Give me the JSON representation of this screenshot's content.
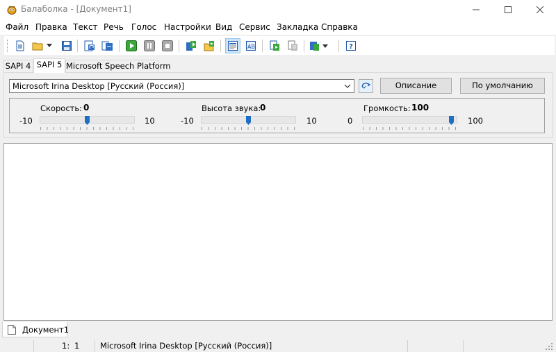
{
  "window": {
    "title": "Балаболка - [Документ1]",
    "icon": "bee-app-icon"
  },
  "menu": [
    "Файл",
    "Правка",
    "Текст",
    "Речь",
    "Голос",
    "Настройки",
    "Вид",
    "Сервис",
    "Закладка",
    "Справка"
  ],
  "toolbar": {
    "icons": [
      "new-document-icon",
      "open-folder-icon",
      "save-icon",
      "export-audio-icon",
      "batch-convert-icon",
      "play-icon",
      "pause-icon",
      "stop-icon",
      "read-clipboard-icon",
      "read-file-icon",
      "toggle-panel-icon",
      "text-format-icon",
      "audio-clip-icon",
      "clip-list-icon",
      "voice-settings-icon",
      "help-icon"
    ]
  },
  "tabs": {
    "items": [
      "SAPI 4",
      "SAPI 5",
      "Microsoft Speech Platform"
    ],
    "active": "SAPI 5"
  },
  "voice": {
    "selected": "Microsoft Irina Desktop [Русский (Россия)]",
    "describe_button": "Описание",
    "default_button": "По умолчанию"
  },
  "sliders": {
    "rate": {
      "label": "Скорость:",
      "value": "0",
      "min": "-10",
      "max": "10",
      "fraction": 0.5
    },
    "pitch": {
      "label": "Высота звука:",
      "value": "0",
      "min": "-10",
      "max": "10",
      "fraction": 0.5
    },
    "volume": {
      "label": "Громкость:",
      "value": "100",
      "min": "0",
      "max": "100",
      "fraction": 1.0
    }
  },
  "document_tab": {
    "label": "Документ1"
  },
  "status": {
    "line": "1:",
    "column": "1",
    "voice": "Microsoft Irina Desktop [Русский (Россия)]"
  },
  "colors": {
    "slider_thumb": "#1e6fc4",
    "active_button": "#cce4f7"
  }
}
